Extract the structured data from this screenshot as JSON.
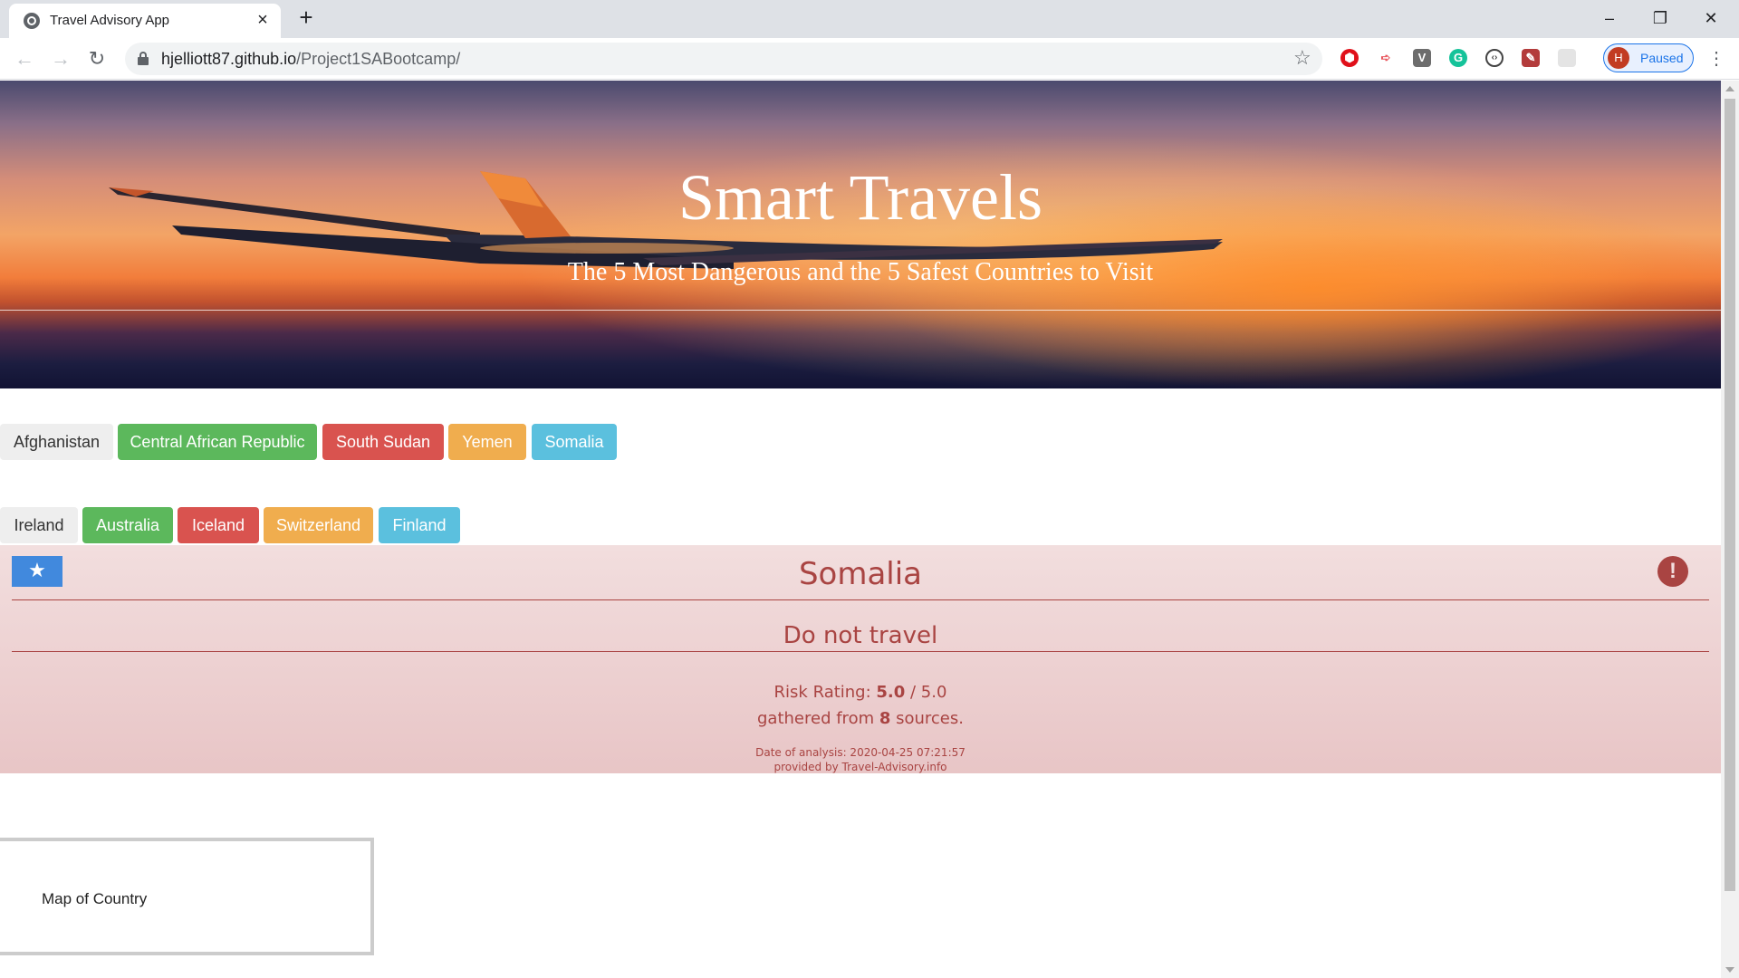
{
  "browser": {
    "tab_title": "Travel Advisory App",
    "url_host": "hjelliott87.github.io",
    "url_path": "/Project1SABootcamp/",
    "profile_initial": "H",
    "profile_status": "Paused"
  },
  "hero": {
    "title": "Smart Travels",
    "subtitle": "The 5 Most Dangerous and the 5 Safest Countries to Visit"
  },
  "dangerous_countries": [
    "Afghanistan",
    "Central African Republic",
    "South Sudan",
    "Yemen",
    "Somalia"
  ],
  "safe_countries": [
    "Ireland",
    "Australia",
    "Iceland",
    "Switzerland",
    "Finland"
  ],
  "advisory": {
    "country": "Somalia",
    "flag_symbol": "★",
    "alert_symbol": "!",
    "advice": "Do not travel",
    "risk_prefix": "Risk Rating: ",
    "risk_score": "5.0",
    "risk_suffix": " / 5.0",
    "sources_prefix": "gathered from ",
    "sources_count": "8",
    "sources_suffix": " sources.",
    "analysis_date": "Date of analysis: 2020-04-25 07:21:57",
    "provider": "provided by Travel-Advisory.info"
  },
  "map": {
    "label": "Map of Country"
  },
  "colors": {
    "default": "#eeeeee",
    "success": "#5cb85c",
    "danger": "#d9534f",
    "warning": "#f0ad4e",
    "info": "#5bc0de",
    "alert_text": "#a94442",
    "alert_bg": "#f2dede"
  }
}
